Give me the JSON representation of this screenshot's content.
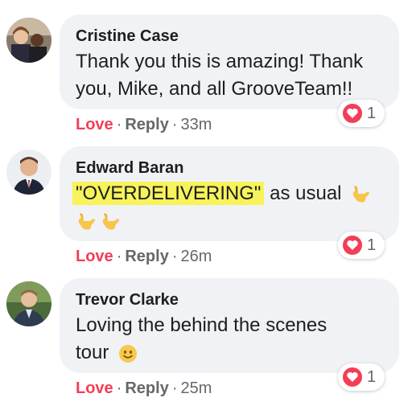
{
  "comments": [
    {
      "author": "Cristine Case",
      "text_line1": "Thank you this is amazing! Thank",
      "text_line2": "you, Mike, and all GrooveTeam!!",
      "reaction_count": "1",
      "reaction_icon": "heart-icon",
      "love_label": "Love",
      "reply_label": "Reply",
      "separator": "·",
      "timestamp": "33m"
    },
    {
      "author": "Edward Baran",
      "highlighted_text": "\"OVERDELIVERING\"",
      "text_rest": " as usual",
      "emoji": "call-me-hand-icon",
      "reaction_count": "1",
      "reaction_icon": "heart-icon",
      "love_label": "Love",
      "reply_label": "Reply",
      "separator": "·",
      "timestamp": "26m"
    },
    {
      "author": "Trevor Clarke",
      "text_line1": "Loving the behind the scenes",
      "text_line2": "tour",
      "emoji": "smiling-face-icon",
      "reaction_count": "1",
      "reaction_icon": "heart-icon",
      "love_label": "Love",
      "reply_label": "Reply",
      "separator": "·",
      "timestamp": "25m"
    }
  ],
  "colors": {
    "bubble": "#f0f2f5",
    "love": "#f33e58",
    "meta": "#65676b",
    "highlight": "#f7f35a"
  }
}
